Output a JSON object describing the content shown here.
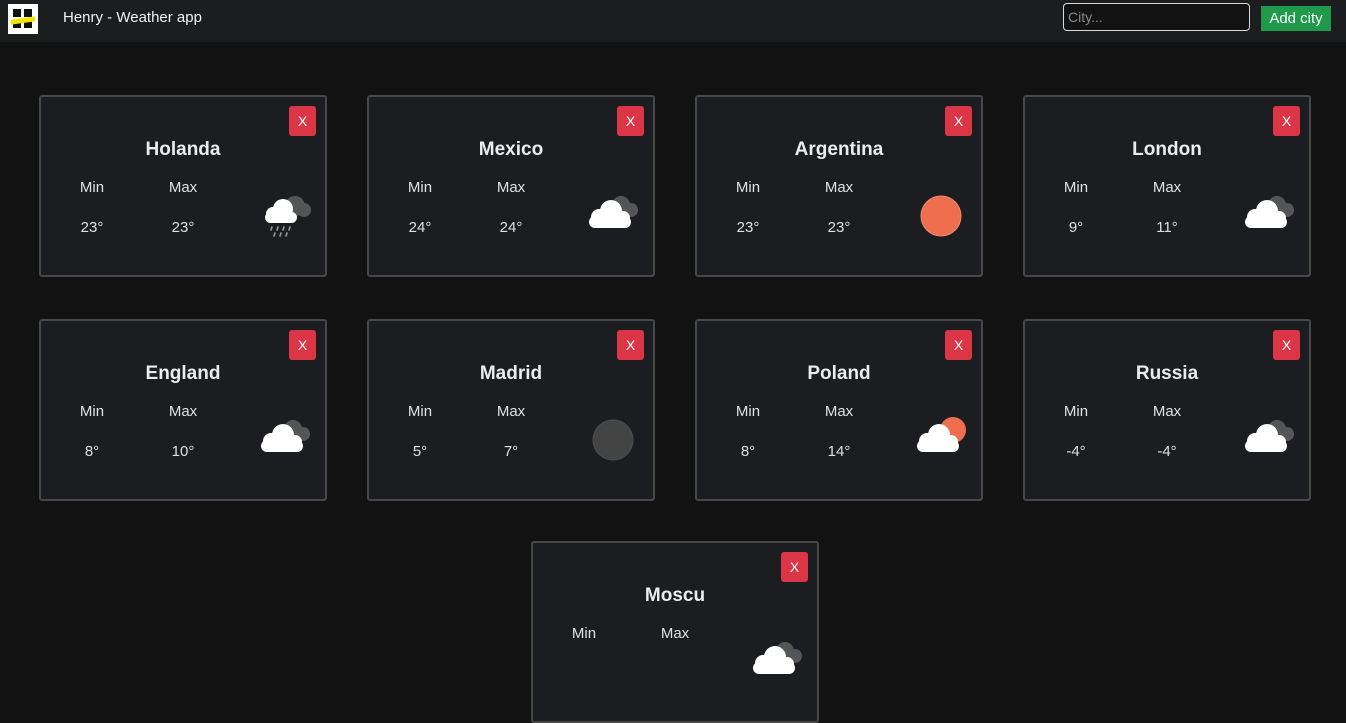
{
  "header": {
    "title": "Henry - Weather app",
    "logo_icon": "henry-logo-icon",
    "search_placeholder": "City...",
    "search_value": "",
    "add_button_label": "Add city"
  },
  "cards": [
    {
      "name": "Holanda",
      "min_label": "Min",
      "max_label": "Max",
      "min": "23°",
      "max": "23°",
      "icon": "rain-cloud-icon",
      "close_label": "X"
    },
    {
      "name": "Mexico",
      "min_label": "Min",
      "max_label": "Max",
      "min": "24°",
      "max": "24°",
      "icon": "broken-clouds-icon",
      "close_label": "X"
    },
    {
      "name": "Argentina",
      "min_label": "Min",
      "max_label": "Max",
      "min": "23°",
      "max": "23°",
      "icon": "clear-sun-icon",
      "close_label": "X"
    },
    {
      "name": "London",
      "min_label": "Min",
      "max_label": "Max",
      "min": "9°",
      "max": "11°",
      "icon": "broken-clouds-icon",
      "close_label": "X"
    },
    {
      "name": "England",
      "min_label": "Min",
      "max_label": "Max",
      "min": "8°",
      "max": "10°",
      "icon": "broken-clouds-icon",
      "close_label": "X"
    },
    {
      "name": "Madrid",
      "min_label": "Min",
      "max_label": "Max",
      "min": "5°",
      "max": "7°",
      "icon": "clear-night-icon",
      "close_label": "X"
    },
    {
      "name": "Poland",
      "min_label": "Min",
      "max_label": "Max",
      "min": "8°",
      "max": "14°",
      "icon": "few-clouds-day-icon",
      "close_label": "X"
    },
    {
      "name": "Russia",
      "min_label": "Min",
      "max_label": "Max",
      "min": "-4°",
      "max": "-4°",
      "icon": "broken-clouds-icon",
      "close_label": "X"
    },
    {
      "name": "Moscu",
      "min_label": "Min",
      "max_label": "Max",
      "min": "",
      "max": "",
      "icon": "broken-clouds-night-icon",
      "close_label": "X"
    }
  ],
  "colors": {
    "background": "#121212",
    "navbar": "#1c1d1f",
    "card": "#1c1d20",
    "card_border": "#484848",
    "close_button": "#dc3545",
    "add_button": "#1f9a4a",
    "sun": "#ee6e4e",
    "moon": "#444444"
  }
}
